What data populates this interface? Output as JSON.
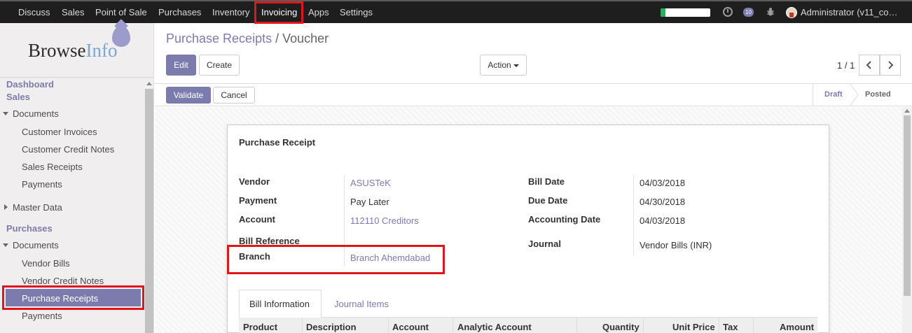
{
  "navbar": {
    "menus": [
      "Discuss",
      "Sales",
      "Point of Sale",
      "Purchases",
      "Inventory",
      "Invoicing",
      "Apps",
      "Settings"
    ],
    "active_menu": "Invoicing",
    "messages_count": "10",
    "user": "Administrator (v11_co…",
    "progress_fraction": 0.1,
    "progress_color": "#21b356"
  },
  "sidebar": {
    "logo_text_a": "Browse",
    "logo_text_b": "Info",
    "dashboard": "Dashboard",
    "sales": {
      "title": "Sales",
      "documents": "Documents",
      "items": [
        "Customer Invoices",
        "Customer Credit Notes",
        "Sales Receipts",
        "Payments"
      ],
      "master_data": "Master Data"
    },
    "purchases": {
      "title": "Purchases",
      "documents": "Documents",
      "items": [
        "Vendor Bills",
        "Vendor Credit Notes",
        "Purchase Receipts",
        "Payments"
      ],
      "active": "Purchase Receipts"
    }
  },
  "breadcrumb": {
    "parent": "Purchase Receipts",
    "separator": "/",
    "current": "Voucher"
  },
  "buttons": {
    "edit": "Edit",
    "create": "Create",
    "action": "Action",
    "validate": "Validate",
    "cancel": "Cancel"
  },
  "pager": {
    "value": "1 / 1"
  },
  "status": {
    "draft": "Draft",
    "posted": "Posted",
    "current": "Draft"
  },
  "form": {
    "title": "Purchase Receipt",
    "left_fields": {
      "vendor": {
        "label": "Vendor",
        "value": "ASUSTeK"
      },
      "payment": {
        "label": "Payment",
        "value": "Pay Later"
      },
      "account": {
        "label": "Account",
        "value": "112110 Creditors"
      },
      "bill_reference": {
        "label": "Bill Reference",
        "value": ""
      },
      "branch": {
        "label": "Branch",
        "value": "Branch Ahemdabad"
      }
    },
    "right_fields": {
      "bill_date": {
        "label": "Bill Date",
        "value": "04/03/2018"
      },
      "due_date": {
        "label": "Due Date",
        "value": "04/30/2018"
      },
      "accounting_date": {
        "label": "Accounting Date",
        "value": "04/03/2018"
      },
      "journal": {
        "label": "Journal",
        "value": "Vendor Bills (INR)"
      }
    },
    "tabs": [
      "Bill Information",
      "Journal Items"
    ],
    "active_tab": "Bill Information",
    "columns": [
      "Product",
      "Description",
      "Account",
      "Analytic Account",
      "Quantity",
      "Unit Price",
      "Tax",
      "Amount"
    ]
  },
  "colors": {
    "brand": "#7c7bad",
    "navbar": "#1e1e1e",
    "highlight": "#e0161c"
  }
}
